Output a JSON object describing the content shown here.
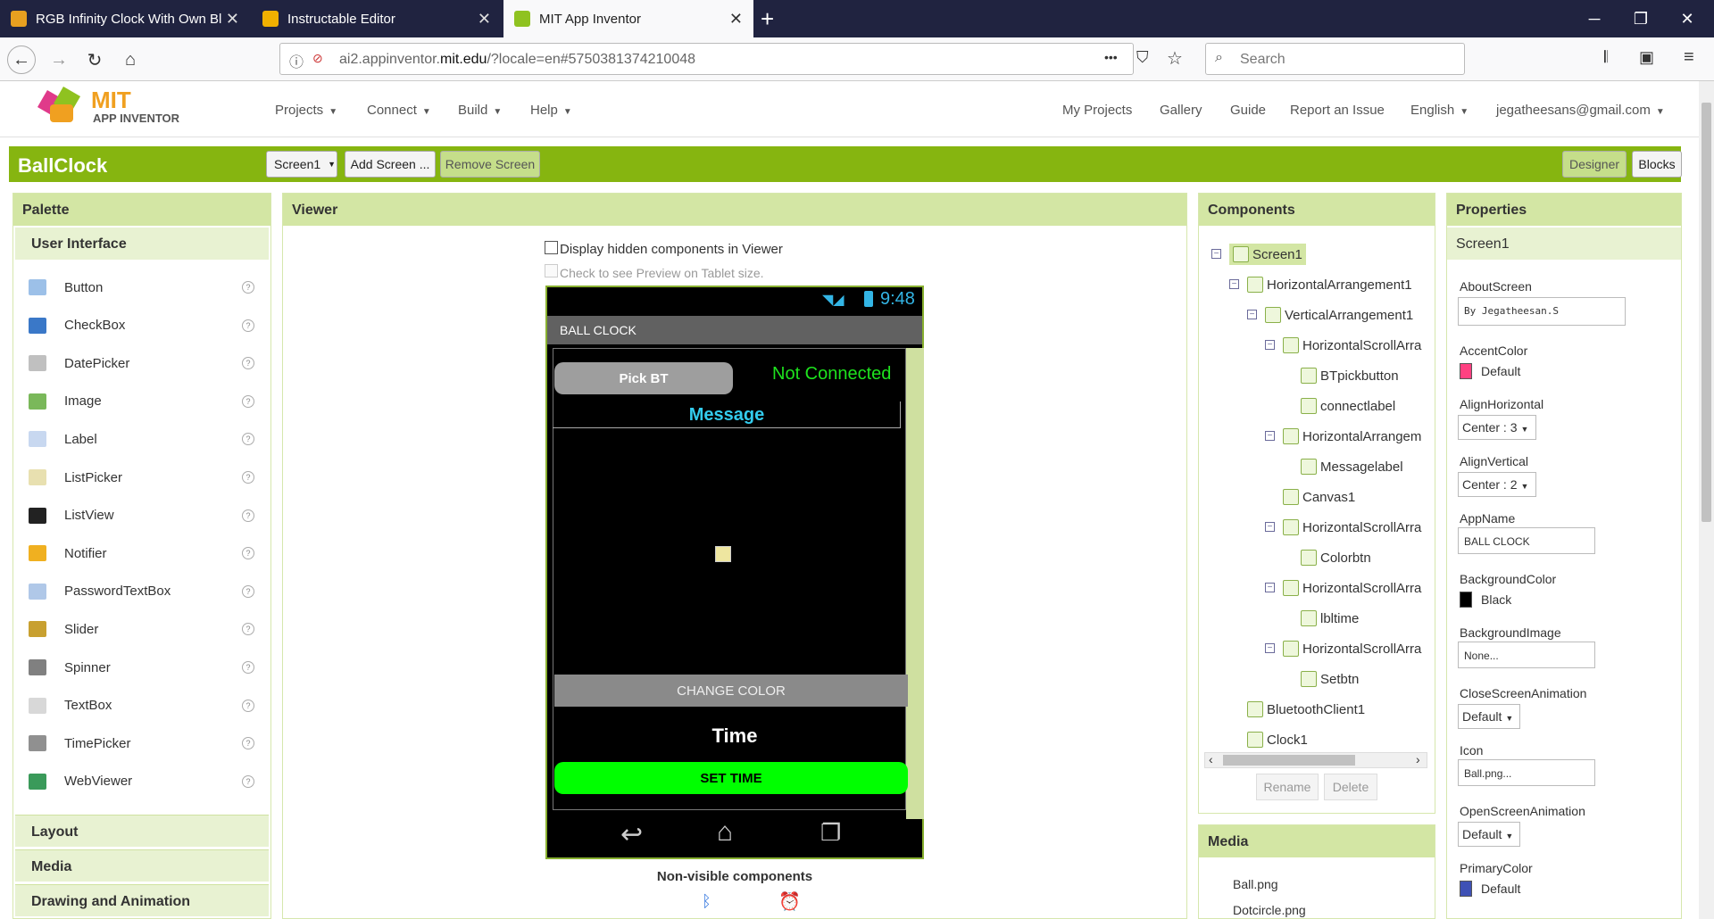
{
  "browser": {
    "tabs": [
      {
        "title": "RGB Infinity Clock With Own Bl",
        "color": "#e8a020"
      },
      {
        "title": "Instructable Editor",
        "color": "#f0b000"
      },
      {
        "title": "MIT App Inventor",
        "color": "#8fc220"
      }
    ],
    "url_prefix": "ai2.appinventor.",
    "url_domain": "mit.edu",
    "url_suffix": "/?locale=en#5750381374210048",
    "search_placeholder": "Search",
    "more": "•••"
  },
  "app": {
    "logo_mit": "MIT",
    "logo_sub": "APP INVENTOR",
    "menus": [
      "Projects",
      "Connect",
      "Build",
      "Help"
    ],
    "right_menus": [
      "My Projects",
      "Gallery",
      "Guide",
      "Report an Issue",
      "English",
      "jegatheesans@gmail.com"
    ],
    "project_name": "BallClock",
    "screen_select": "Screen1",
    "add_screen": "Add Screen ...",
    "remove_screen": "Remove Screen",
    "designer": "Designer",
    "blocks": "Blocks"
  },
  "palette": {
    "title": "Palette",
    "section": "User Interface",
    "items": [
      "Button",
      "CheckBox",
      "DatePicker",
      "Image",
      "Label",
      "ListPicker",
      "ListView",
      "Notifier",
      "PasswordTextBox",
      "Slider",
      "Spinner",
      "TextBox",
      "TimePicker",
      "WebViewer"
    ],
    "sections": [
      "Layout",
      "Media",
      "Drawing and Animation"
    ],
    "help": "?"
  },
  "viewer": {
    "title": "Viewer",
    "hidden_check": "Display hidden components in Viewer",
    "tablet_check": "Check to see Preview on Tablet size.",
    "time": "9:48",
    "app_title": "BALL CLOCK",
    "pick_bt": "Pick BT",
    "not_connected": "Not Connected",
    "message": "Message",
    "change_color": "CHANGE COLOR",
    "time_label": "Time",
    "set_time": "SET TIME",
    "nonvisible": "Non-visible components"
  },
  "components": {
    "title": "Components",
    "tree": [
      {
        "label": "Screen1",
        "level": 0,
        "toggle": true
      },
      {
        "label": "HorizontalArrangement1",
        "level": 1,
        "toggle": true
      },
      {
        "label": "VerticalArrangement1",
        "level": 2,
        "toggle": true
      },
      {
        "label": "HorizontalScrollArra",
        "level": 3,
        "toggle": true
      },
      {
        "label": "BTpickbutton",
        "level": 4,
        "toggle": false
      },
      {
        "label": "connectlabel",
        "level": 4,
        "toggle": false
      },
      {
        "label": "HorizontalArrangem",
        "level": 3,
        "toggle": true
      },
      {
        "label": "Messagelabel",
        "level": 4,
        "toggle": false
      },
      {
        "label": "Canvas1",
        "level": 3,
        "toggle": false
      },
      {
        "label": "HorizontalScrollArra",
        "level": 3,
        "toggle": true
      },
      {
        "label": "Colorbtn",
        "level": 4,
        "toggle": false
      },
      {
        "label": "HorizontalScrollArra",
        "level": 3,
        "toggle": true
      },
      {
        "label": "lbltime",
        "level": 4,
        "toggle": false
      },
      {
        "label": "HorizontalScrollArra",
        "level": 3,
        "toggle": true
      },
      {
        "label": "Setbtn",
        "level": 4,
        "toggle": false
      },
      {
        "label": "BluetoothClient1",
        "level": 1,
        "toggle": false
      },
      {
        "label": "Clock1",
        "level": 1,
        "toggle": false
      }
    ],
    "rename": "Rename",
    "delete": "Delete"
  },
  "media": {
    "title": "Media",
    "files": [
      "Ball.png",
      "Dotcircle.png"
    ]
  },
  "properties": {
    "title": "Properties",
    "component": "Screen1",
    "about_label": "AboutScreen",
    "about_value": "By Jegatheesan.S",
    "accent_label": "AccentColor",
    "accent_value": "Default",
    "accent_color": "#ff4081",
    "alignh_label": "AlignHorizontal",
    "alignh_value": "Center : 3",
    "alignv_label": "AlignVertical",
    "alignv_value": "Center : 2",
    "appname_label": "AppName",
    "appname_value": "BALL CLOCK",
    "bgcolor_label": "BackgroundColor",
    "bgcolor_value": "Black",
    "bgimage_label": "BackgroundImage",
    "bgimage_value": "None...",
    "closeanim_label": "CloseScreenAnimation",
    "closeanim_value": "Default",
    "icon_label": "Icon",
    "icon_value": "Ball.png...",
    "openanim_label": "OpenScreenAnimation",
    "openanim_value": "Default",
    "primary_label": "PrimaryColor",
    "primary_value": "Default",
    "primary_color": "#3f51b5"
  }
}
